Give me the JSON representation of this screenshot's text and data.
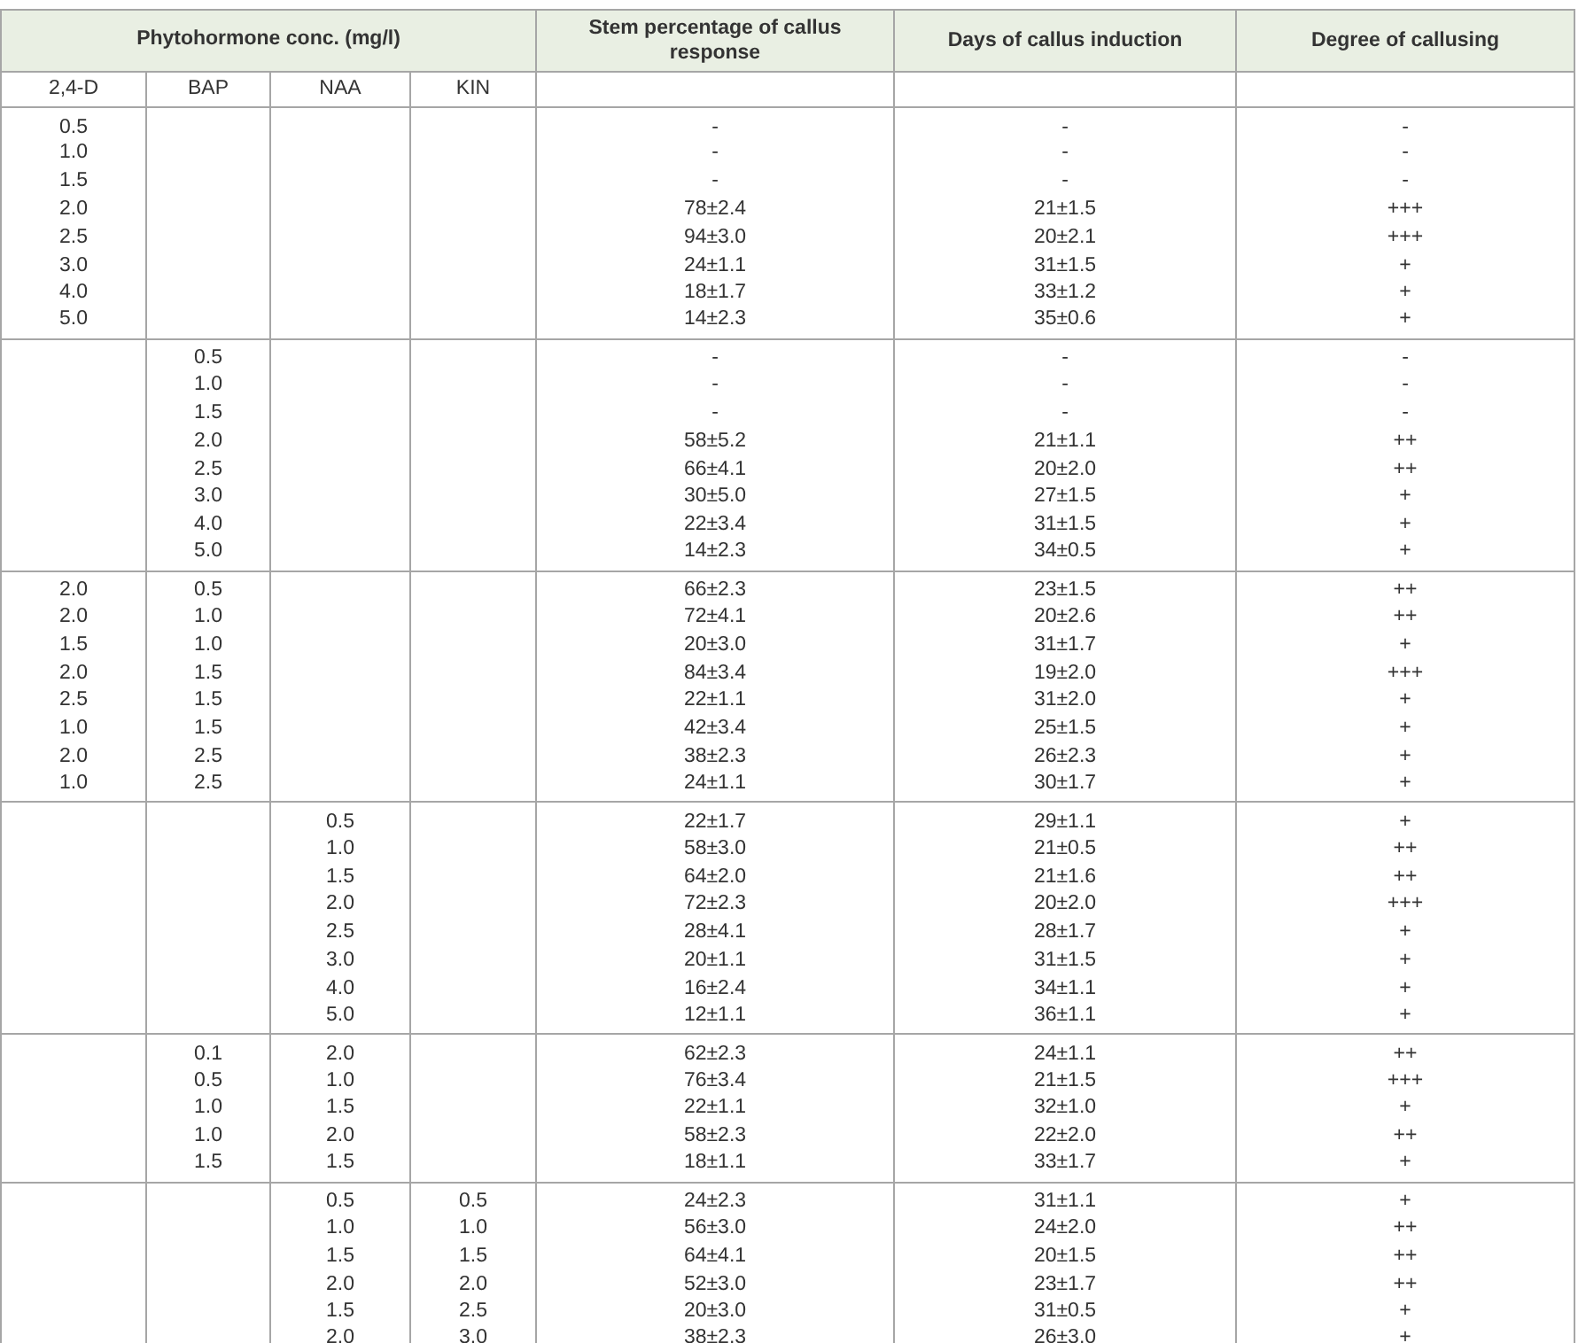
{
  "table": {
    "header": {
      "group_heading": "Phytohormone conc. (mg/l)",
      "columns": [
        "Stem percentage of callus response",
        "Days of callus induction",
        "Degree of callusing"
      ],
      "sub_columns": [
        "2,4-D",
        "BAP",
        "NAA",
        "KIN"
      ]
    },
    "groups": [
      [
        {
          "d24": "0.5",
          "stem": "-",
          "days": "-",
          "degree": "-"
        },
        {
          "d24": "1.0",
          "stem": "-",
          "days": "-",
          "degree": "-"
        },
        {
          "d24": "1.5",
          "stem": "-",
          "days": "-",
          "degree": "-"
        },
        {
          "d24": "2.0",
          "stem": "78±2.4",
          "days": "21±1.5",
          "degree": "+++"
        },
        {
          "d24": "2.5",
          "stem": "94±3.0",
          "days": "20±2.1",
          "degree": "+++"
        },
        {
          "d24": "3.0",
          "stem": "24±1.1",
          "days": "31±1.5",
          "degree": "+"
        },
        {
          "d24": "4.0",
          "stem": "18±1.7",
          "days": "33±1.2",
          "degree": "+"
        },
        {
          "d24": "5.0",
          "stem": "14±2.3",
          "days": "35±0.6",
          "degree": "+"
        }
      ],
      [
        {
          "bap": "0.5",
          "stem": "-",
          "days": "-",
          "degree": "-"
        },
        {
          "bap": "1.0",
          "stem": "-",
          "days": "-",
          "degree": "-"
        },
        {
          "bap": "1.5",
          "stem": "-",
          "days": "-",
          "degree": "-"
        },
        {
          "bap": "2.0",
          "stem": "58±5.2",
          "days": "21±1.1",
          "degree": "++"
        },
        {
          "bap": "2.5",
          "stem": "66±4.1",
          "days": "20±2.0",
          "degree": "++"
        },
        {
          "bap": "3.0",
          "stem": "30±5.0",
          "days": "27±1.5",
          "degree": "+"
        },
        {
          "bap": "4.0",
          "stem": "22±3.4",
          "days": "31±1.5",
          "degree": "+"
        },
        {
          "bap": "5.0",
          "stem": "14±2.3",
          "days": "34±0.5",
          "degree": "+"
        }
      ],
      [
        {
          "d24": "2.0",
          "bap": "0.5",
          "stem": "66±2.3",
          "days": "23±1.5",
          "degree": "++"
        },
        {
          "d24": "2.0",
          "bap": "1.0",
          "stem": "72±4.1",
          "days": "20±2.6",
          "degree": "++"
        },
        {
          "d24": "1.5",
          "bap": "1.0",
          "stem": "20±3.0",
          "days": "31±1.7",
          "degree": "+"
        },
        {
          "d24": "2.0",
          "bap": "1.5",
          "stem": "84±3.4",
          "days": "19±2.0",
          "degree": "+++"
        },
        {
          "d24": "2.5",
          "bap": "1.5",
          "stem": "22±1.1",
          "days": "31±2.0",
          "degree": "+"
        },
        {
          "d24": "1.0",
          "bap": "1.5",
          "stem": "42±3.4",
          "days": "25±1.5",
          "degree": "+"
        },
        {
          "d24": "2.0",
          "bap": "2.5",
          "stem": "38±2.3",
          "days": "26±2.3",
          "degree": "+"
        },
        {
          "d24": "1.0",
          "bap": "2.5",
          "stem": "24±1.1",
          "days": "30±1.7",
          "degree": "+"
        }
      ],
      [
        {
          "naa": "0.5",
          "stem": "22±1.7",
          "days": "29±1.1",
          "degree": "+"
        },
        {
          "naa": "1.0",
          "stem": "58±3.0",
          "days": "21±0.5",
          "degree": "++"
        },
        {
          "naa": "1.5",
          "stem": "64±2.0",
          "days": "21±1.6",
          "degree": "++"
        },
        {
          "naa": "2.0",
          "stem": "72±2.3",
          "days": "20±2.0",
          "degree": "+++"
        },
        {
          "naa": "2.5",
          "stem": "28±4.1",
          "days": "28±1.7",
          "degree": "+"
        },
        {
          "naa": "3.0",
          "stem": "20±1.1",
          "days": "31±1.5",
          "degree": "+"
        },
        {
          "naa": "4.0",
          "stem": "16±2.4",
          "days": "34±1.1",
          "degree": "+"
        },
        {
          "naa": "5.0",
          "stem": "12±1.1",
          "days": "36±1.1",
          "degree": "+"
        }
      ],
      [
        {
          "bap": "0.1",
          "naa": "2.0",
          "stem": "62±2.3",
          "days": "24±1.1",
          "degree": "++"
        },
        {
          "bap": "0.5",
          "naa": "1.0",
          "stem": "76±3.4",
          "days": "21±1.5",
          "degree": "+++"
        },
        {
          "bap": "1.0",
          "naa": "1.5",
          "stem": "22±1.1",
          "days": "32±1.0",
          "degree": "+"
        },
        {
          "bap": "1.0",
          "naa": "2.0",
          "stem": "58±2.3",
          "days": "22±2.0",
          "degree": "++"
        },
        {
          "bap": "1.5",
          "naa": "1.5",
          "stem": "18±1.1",
          "days": "33±1.7",
          "degree": "+"
        }
      ],
      [
        {
          "naa": "0.5",
          "kin": "0.5",
          "stem": "24±2.3",
          "days": "31±1.1",
          "degree": "+"
        },
        {
          "naa": "1.0",
          "kin": "1.0",
          "stem": "56±3.0",
          "days": "24±2.0",
          "degree": "++"
        },
        {
          "naa": "1.5",
          "kin": "1.5",
          "stem": "64±4.1",
          "days": "20±1.5",
          "degree": "++"
        },
        {
          "naa": "2.0",
          "kin": "2.0",
          "stem": "52±3.0",
          "days": "23±1.7",
          "degree": "++"
        },
        {
          "naa": "1.5",
          "kin": "2.5",
          "stem": "20±3.0",
          "days": "31±0.5",
          "degree": "+"
        },
        {
          "naa": "2.0",
          "kin": "3.0",
          "stem": "38±2.3",
          "days": "26±3.0",
          "degree": "+"
        }
      ]
    ]
  }
}
